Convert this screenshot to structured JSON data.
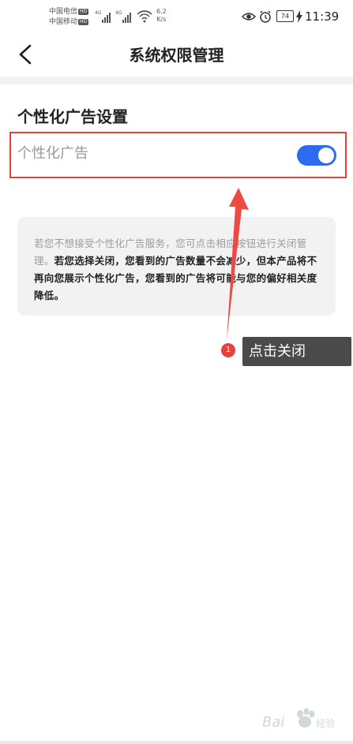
{
  "status_bar": {
    "carrier_1": "中国电信",
    "carrier_2": "中国移动",
    "hd_badge": "HD",
    "net_type": "4G",
    "speed_value": "6.2",
    "speed_unit": "K/s",
    "battery": "74",
    "time": "11:39"
  },
  "header": {
    "title": "系统权限管理",
    "back_icon": "chevron-left-icon"
  },
  "section": {
    "title": "个性化广告设置",
    "setting_label": "个性化广告",
    "toggle_on": true
  },
  "info": {
    "text_light": "若您不想接受个性化广告服务，您可点击相应按钮进行关闭管理。",
    "text_dark": "若您选择关闭，您看到的广告数量不会减少，但本产品将不再向您展示个性化广告，您看到的广告将可能与您的偏好相关度降低。"
  },
  "annotation": {
    "step_number": "1",
    "tooltip": "点击关闭"
  },
  "colors": {
    "highlight_border": "#e8403c",
    "toggle_on": "#2b6cf0",
    "tooltip_bg": "#4a4a4a",
    "info_bg": "#f2f2f3"
  }
}
